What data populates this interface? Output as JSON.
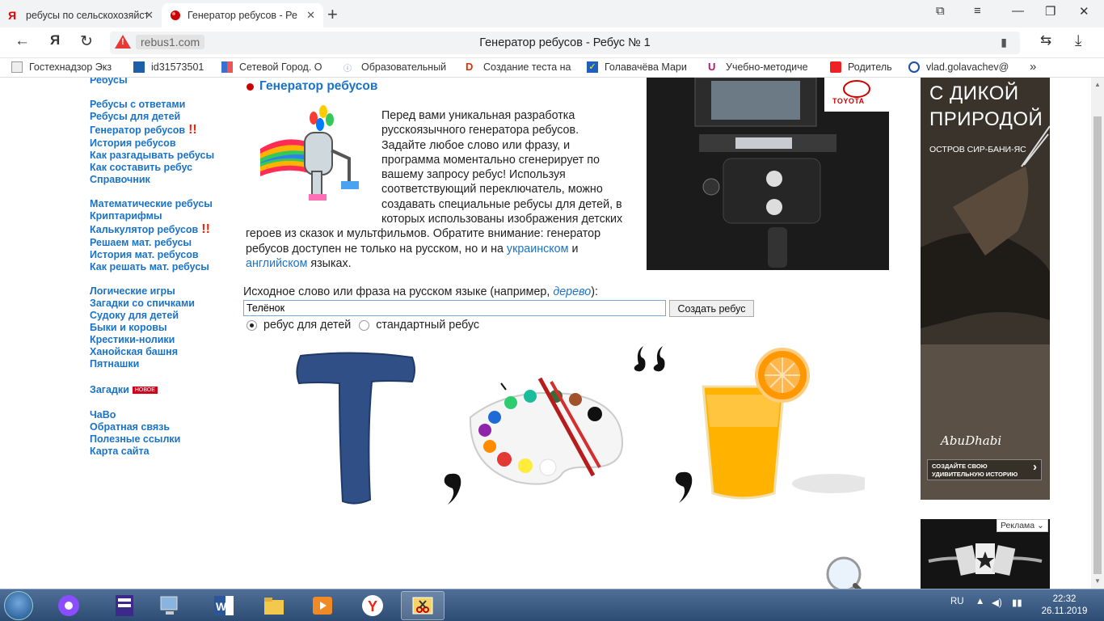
{
  "browser": {
    "tabs": [
      {
        "label": "ребусы по сельскохозяйст",
        "active": false
      },
      {
        "label": "Генератор ребусов - Ре",
        "active": true
      }
    ],
    "url_domain": "rebus1.com",
    "page_title": "Генератор ребусов - Ребус № 1",
    "bookmarks": [
      "Гостехнадзор Экз",
      "id31573501",
      "Сетевой Город. О",
      "Образовательный",
      "Создание теста на",
      "Голавачёва Мари",
      "Учебно-методиче",
      "Родитель",
      "vlad.golavachev@"
    ],
    "more_bookmarks": "»"
  },
  "sidebar": {
    "groups": [
      [
        "Ребусы",
        "Ребусы с ответами",
        "Ребусы для детей",
        "Генератор ребусов",
        "История ребусов",
        "Как разгадывать ребусы",
        "Как составить ребус",
        "Справочник"
      ],
      [
        "Математические ребусы",
        "Криптарифмы",
        "Калькулятор ребусов",
        "Решаем мат. ребусы",
        "История мат. ребусов",
        "Как решать мат. ребусы"
      ],
      [
        "Логические игры",
        "Загадки со спичками",
        "Судоку для детей",
        "Быки и коровы",
        "Крестики-нолики",
        "Ханойская башня",
        "Пятнашки"
      ],
      [
        "Загадки"
      ],
      [
        "ЧаВо",
        "Обратная связь",
        "Полезные ссылки",
        "Карта сайта"
      ]
    ],
    "excl_mark": "!!",
    "new_badge": "НОВОЕ"
  },
  "main": {
    "heading": "Генератор ребусов",
    "intro_text": "Перед вами уникальная разработка русскоязычного генератора ребусов. Задайте любое слово или фразу, и программа моментально сгенерирует по вашему запросу ребус! Используя соответствующий переключатель, можно создавать специальные ребусы для детей, в которых использованы изображения детских героев из сказок и мультфильмов. Обратите внимание: генератор ребусов доступен не только на русском, но и на",
    "link_ukr": "украинском",
    "and": " и ",
    "link_eng": "английском",
    "tail": " языках.",
    "form_label_prefix": "Исходное слово или фраза на русском языке (например, ",
    "form_label_example": "дерево",
    "form_label_suffix": "):",
    "input_value": "Телёнок",
    "submit_label": "Создать ребус",
    "radio_kids": "ребус для детей",
    "radio_standard": "стандартный ребус",
    "rebus_letter": "Т"
  },
  "ads": {
    "car_brand": "TOYOTA",
    "right_title": "С ДИКОЙ ПРИРОДОЙ",
    "right_sub": "ОСТРОВ СИР-БАНИ-ЯС",
    "right_logo": "AbuDhabi",
    "right_cta": "СОЗДАЙТЕ СВОЮ УДИВИТЕЛЬНУЮ ИСТОРИЮ",
    "ad_tag": "Реклама"
  },
  "taskbar": {
    "lang": "RU",
    "time": "22:32",
    "date": "26.11.2019"
  }
}
